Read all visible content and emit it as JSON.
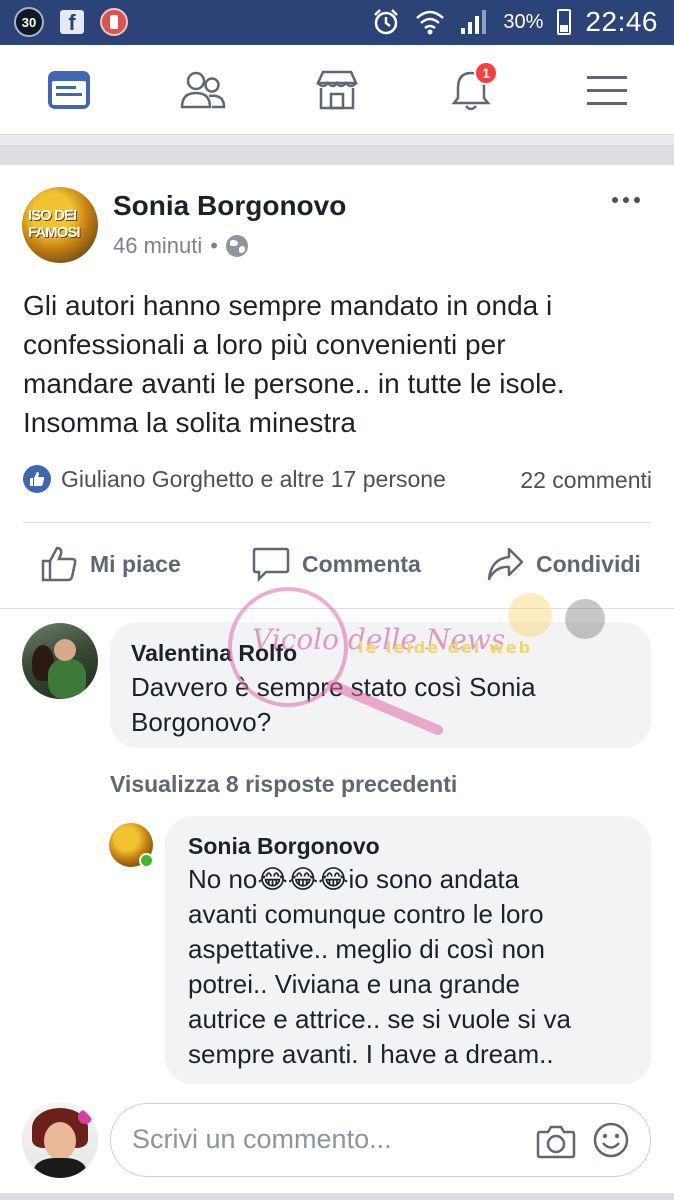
{
  "status_bar": {
    "notif_count": "30",
    "battery": "30%",
    "time": "22:46"
  },
  "navbar": {
    "notifications_badge": "1"
  },
  "post": {
    "author": "Sonia Borgonovo",
    "time": "46 minuti",
    "separator": "•",
    "text": "Gli autori hanno sempre mandato in onda i\nconfessionali a loro più convenienti per\nmandare avanti le persone.. in tutte le isole.\nInsomma la solita minestra",
    "reactions_text": "Giuliano Gorghetto e altre 17 persone",
    "comments_count": "22 commenti",
    "avatar_text": "ISO DEI FAMOSI"
  },
  "actions": {
    "like": "Mi piace",
    "comment": "Commenta",
    "share": "Condividi"
  },
  "comments": [
    {
      "author": "Valentina Rolfo",
      "text": "Davvero è sempre stato così Sonia\nBorgonovo?"
    },
    {
      "author": "Sonia Borgonovo",
      "text": "No no😂😂😂io sono andata\navanti comunque contro le loro\naspettative.. meglio di così non\npotrei.. Viviana e una grande\nautrice e attrice.. se si vuole si va\nsempre avanti. I have a dream.."
    }
  ],
  "replies_link": "Visualizza 8 risposte precedenti",
  "watermark": {
    "text": "Vicolo delle News",
    "tagline": "le leide del web"
  },
  "composer": {
    "placeholder": "Scrivi un commento..."
  },
  "icons": {
    "nav": [
      "news-feed-icon",
      "friends-icon",
      "marketplace-icon",
      "notifications-icon",
      "menu-icon"
    ],
    "composer": [
      "camera-icon",
      "emoji-icon"
    ]
  },
  "colors": {
    "status_bar": "#2b4377",
    "accent": "#4267b2",
    "badge": "#fa3e3e"
  }
}
